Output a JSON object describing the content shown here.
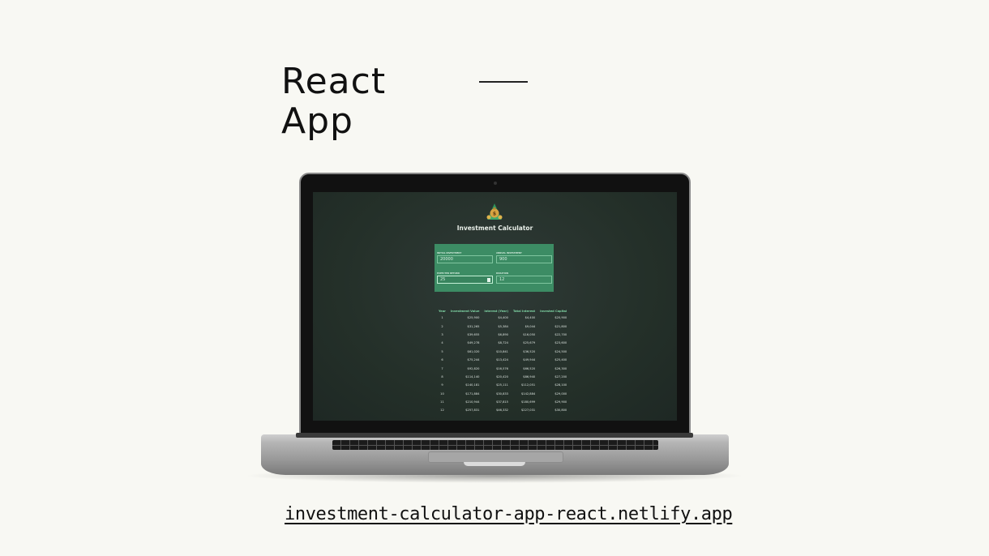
{
  "slide": {
    "title_line1": "React",
    "title_line2": "App",
    "url": "investment-calculator-app-react.netlify.app"
  },
  "app": {
    "title": "Investment Calculator",
    "logo_icon": "money-bag-icon",
    "fields": [
      {
        "label": "Initial Investment",
        "value": "20000"
      },
      {
        "label": "Annual Investment",
        "value": "900"
      },
      {
        "label": "Expected Return",
        "value": "25"
      },
      {
        "label": "Duration",
        "value": "12"
      }
    ],
    "table": {
      "headers": [
        "Year",
        "Investment Value",
        "Interest (Year)",
        "Total Interest",
        "Invested Capital"
      ],
      "rows": [
        [
          "1",
          "$25,900",
          "$4,400",
          "$4,400",
          "$20,900"
        ],
        [
          "2",
          "$31,265",
          "$5,384",
          "$9,044",
          "$21,800"
        ],
        [
          "3",
          "$39,655",
          "$6,890",
          "$16,050",
          "$22,700"
        ],
        [
          "4",
          "$49,278",
          "$8,724",
          "$25,679",
          "$23,600"
        ],
        [
          "5",
          "$61,020",
          "$10,841",
          "$36,520",
          "$24,500"
        ],
        [
          "6",
          "$75,244",
          "$13,424",
          "$49,944",
          "$25,400"
        ],
        [
          "7",
          "$92,820",
          "$16,576",
          "$66,520",
          "$26,300"
        ],
        [
          "8",
          "$114,140",
          "$20,420",
          "$86,940",
          "$27,200"
        ],
        [
          "9",
          "$140,181",
          "$25,111",
          "$112,051",
          "$28,100"
        ],
        [
          "10",
          "$171,884",
          "$30,833",
          "$142,884",
          "$29,000"
        ],
        [
          "11",
          "$210,944",
          "$37,815",
          "$180,699",
          "$29,900"
        ],
        [
          "12",
          "$257,831",
          "$46,332",
          "$227,031",
          "$30,800"
        ]
      ]
    }
  },
  "colors": {
    "page_bg": "#f8f8f3",
    "form_bg": "#3c8c64",
    "table_header": "#7fd4a4"
  }
}
